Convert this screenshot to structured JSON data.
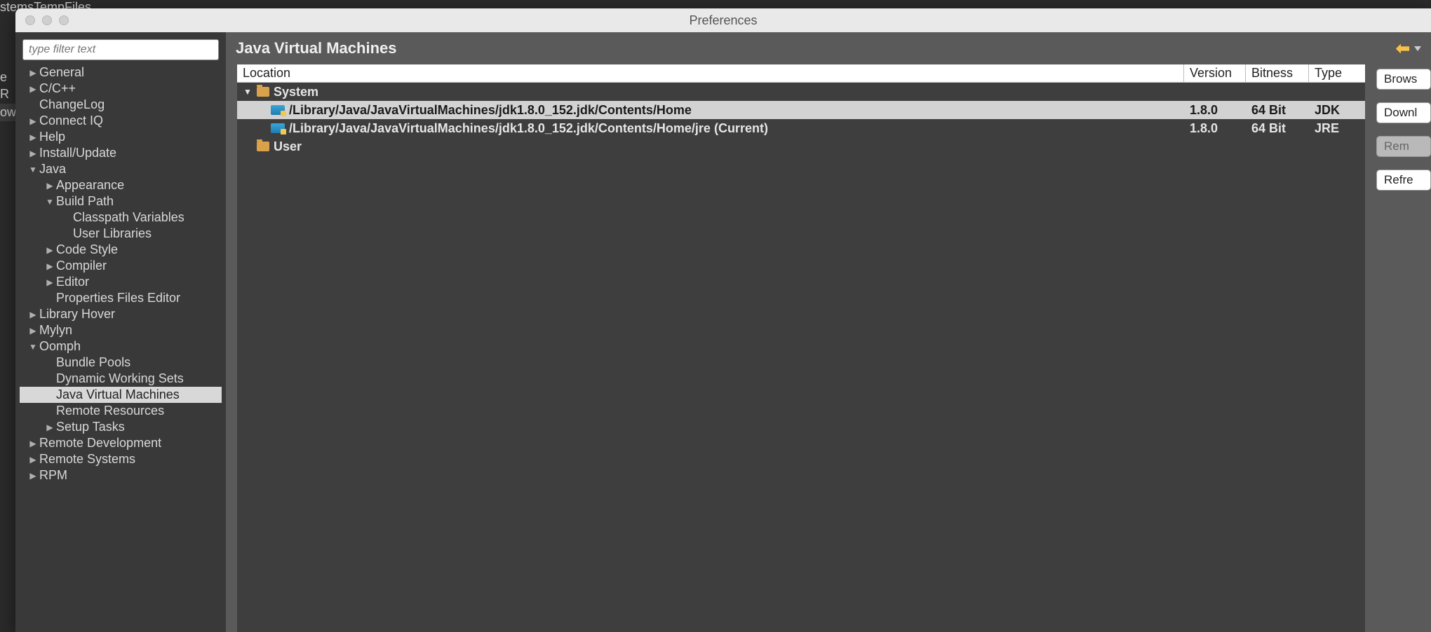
{
  "bg": {
    "top": "stemsTempFiles",
    "e": "e",
    "r": "R",
    "ow": "owe"
  },
  "dialog": {
    "title": "Preferences"
  },
  "sidebar": {
    "filter_placeholder": "type filter text",
    "nodes": [
      {
        "indent": 1,
        "tw": "right",
        "label": "General"
      },
      {
        "indent": 1,
        "tw": "right",
        "label": "C/C++"
      },
      {
        "indent": 1,
        "tw": "none",
        "label": "ChangeLog"
      },
      {
        "indent": 1,
        "tw": "right",
        "label": "Connect IQ"
      },
      {
        "indent": 1,
        "tw": "right",
        "label": "Help"
      },
      {
        "indent": 1,
        "tw": "right",
        "label": "Install/Update"
      },
      {
        "indent": 1,
        "tw": "down",
        "label": "Java"
      },
      {
        "indent": 2,
        "tw": "right",
        "label": "Appearance"
      },
      {
        "indent": 2,
        "tw": "down",
        "label": "Build Path"
      },
      {
        "indent": 3,
        "tw": "none",
        "label": "Classpath Variables"
      },
      {
        "indent": 3,
        "tw": "none",
        "label": "User Libraries"
      },
      {
        "indent": 2,
        "tw": "right",
        "label": "Code Style"
      },
      {
        "indent": 2,
        "tw": "right",
        "label": "Compiler"
      },
      {
        "indent": 2,
        "tw": "right",
        "label": "Editor"
      },
      {
        "indent": 2,
        "tw": "none",
        "label": "Properties Files Editor"
      },
      {
        "indent": 1,
        "tw": "right",
        "label": "Library Hover"
      },
      {
        "indent": 1,
        "tw": "right",
        "label": "Mylyn"
      },
      {
        "indent": 1,
        "tw": "down",
        "label": "Oomph"
      },
      {
        "indent": 2,
        "tw": "none",
        "label": "Bundle Pools"
      },
      {
        "indent": 2,
        "tw": "none",
        "label": "Dynamic Working Sets"
      },
      {
        "indent": 2,
        "tw": "none",
        "label": "Java Virtual Machines",
        "selected": true
      },
      {
        "indent": 2,
        "tw": "none",
        "label": "Remote Resources"
      },
      {
        "indent": 2,
        "tw": "right",
        "label": "Setup Tasks"
      },
      {
        "indent": 1,
        "tw": "right",
        "label": "Remote Development"
      },
      {
        "indent": 1,
        "tw": "right",
        "label": "Remote Systems"
      },
      {
        "indent": 1,
        "tw": "right",
        "label": "RPM"
      }
    ]
  },
  "main": {
    "heading": "Java Virtual Machines",
    "columns": {
      "location": "Location",
      "version": "Version",
      "bitness": "Bitness",
      "type": "Type"
    },
    "rows": [
      {
        "kind": "group",
        "tw": "down",
        "icon": "folder",
        "label": "System",
        "indent": 0
      },
      {
        "kind": "jvm",
        "icon": "jdk",
        "label": "/Library/Java/JavaVirtualMachines/jdk1.8.0_152.jdk/Contents/Home",
        "version": "1.8.0",
        "bitness": "64 Bit",
        "type": "JDK",
        "indent": 1,
        "selected": true
      },
      {
        "kind": "jvm",
        "icon": "jdk",
        "label": "/Library/Java/JavaVirtualMachines/jdk1.8.0_152.jdk/Contents/Home/jre (Current)",
        "version": "1.8.0",
        "bitness": "64 Bit",
        "type": "JRE",
        "indent": 1
      },
      {
        "kind": "group",
        "tw": "none",
        "icon": "folder",
        "label": "User",
        "indent": 0
      }
    ],
    "buttons": [
      {
        "label": "Brows",
        "name": "browse-button",
        "disabled": false
      },
      {
        "label": "Downl",
        "name": "download-button",
        "disabled": false
      },
      {
        "label": "Rem",
        "name": "remove-button",
        "disabled": true
      },
      {
        "label": "Refre",
        "name": "refresh-button",
        "disabled": false
      }
    ]
  }
}
